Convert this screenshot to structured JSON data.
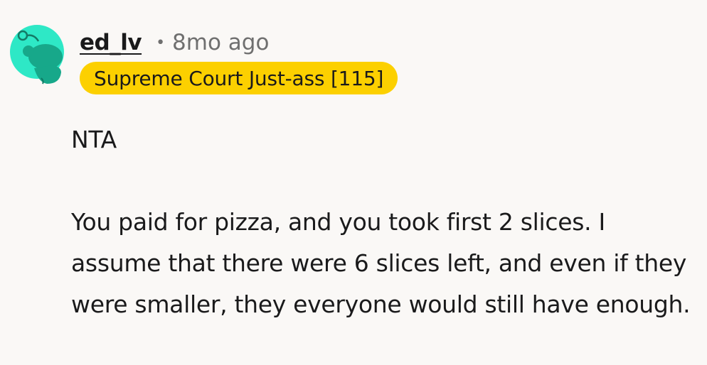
{
  "comment": {
    "username": "ed_lv",
    "separator": "•",
    "timestamp": "8mo ago",
    "flair": "Supreme Court Just-ass [115]",
    "flair_color": "#fcd000",
    "avatar_icon": "snoo-avatar-icon",
    "avatar_color": "#2ee8c6",
    "verdict": "NTA",
    "text": "You paid for pizza, and you took first 2 slices. I assume that there were 6 slices left, and even if they were smaller, they everyone would still have enough."
  }
}
